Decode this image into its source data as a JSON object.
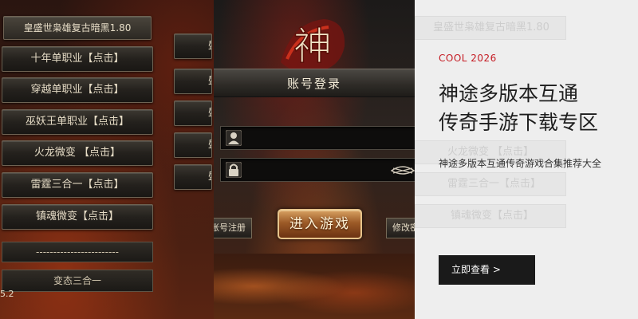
{
  "left": {
    "title": "皇盛世枭雄复古暗黑1.80",
    "servers": [
      "十年单职业【点击】",
      "穿越单职业【点击】",
      "巫妖王单职业【点击】",
      "火龙微变 【点击】",
      "雷霆三合一【点击】",
      "镇魂微变【点击】"
    ],
    "divider": "------------------------",
    "partial": "变态三合一",
    "right_labels": [
      "盛",
      "盛",
      "盛",
      "盛",
      "盛"
    ],
    "version": "5.2"
  },
  "login": {
    "logo_glyph": "神",
    "title": "账号登录",
    "username_value": "",
    "password_value": "",
    "enter_label": "进入游戏",
    "register_label": "账号注册",
    "modify_label": "修改密码"
  },
  "promo": {
    "tag": "COOL 2026",
    "headline_line1": "神途多版本互通",
    "headline_line2": "传奇手游下载专区",
    "description": "神途多版本互通传奇游戏合集推荐大全",
    "cta_label": "立即查看 >",
    "ghost_buttons": [
      "皇盛世枭雄复古暗黑1.80",
      "火龙微变 【点击】",
      "雷霆三合一【点击】",
      "镇魂微变【点击】"
    ]
  },
  "colors": {
    "accent_red": "#c51c24",
    "cta_bg": "#1a1a1a",
    "promo_bg": "#eeeeee"
  }
}
